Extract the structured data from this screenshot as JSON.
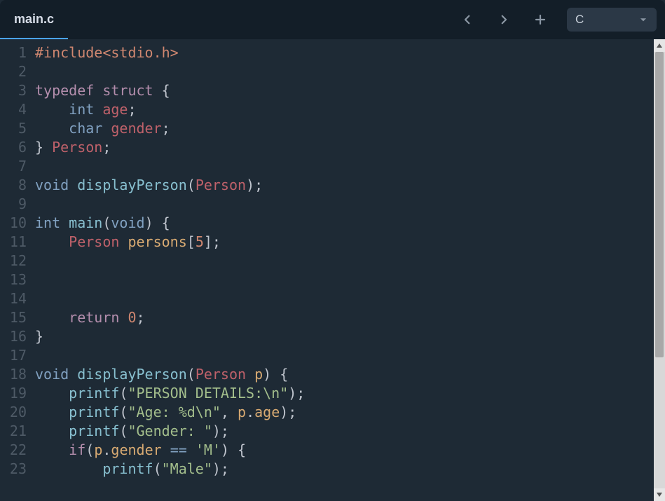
{
  "tab": {
    "filename": "main.c"
  },
  "toolbar": {
    "language": "C"
  },
  "gutter": [
    "1",
    "2",
    "3",
    "4",
    "5",
    "6",
    "7",
    "8",
    "9",
    "10",
    "11",
    "12",
    "13",
    "14",
    "15",
    "16",
    "17",
    "18",
    "19",
    "20",
    "21",
    "22",
    "23"
  ],
  "code": {
    "l1": {
      "preproc": "#include<stdio.h>"
    },
    "l3": {
      "typedef": "typedef",
      "struct": "struct",
      "brace": " {"
    },
    "l4": {
      "indent": "    ",
      "type": "int",
      "sp": " ",
      "name": "age",
      "semi": ";"
    },
    "l5": {
      "indent": "    ",
      "type": "char",
      "sp": " ",
      "name": "gender",
      "semi": ";"
    },
    "l6": {
      "brace": "} ",
      "name": "Person",
      "semi": ";"
    },
    "l8": {
      "void": "void",
      "sp": " ",
      "fn": "displayPerson",
      "open": "(",
      "param": "Person",
      "close": ");"
    },
    "l10": {
      "int": "int",
      "sp": " ",
      "fn": "main",
      "open": "(",
      "void": "void",
      "close": ") {"
    },
    "l11": {
      "indent": "    ",
      "type": "Person",
      "sp": " ",
      "name": "persons",
      "br": "[",
      "num": "5",
      "brc": "];"
    },
    "l15": {
      "indent": "    ",
      "ret": "return",
      "sp": " ",
      "num": "0",
      "semi": ";"
    },
    "l16": {
      "brace": "}"
    },
    "l18": {
      "void": "void",
      "sp": " ",
      "fn": "displayPerson",
      "open": "(",
      "type": "Person",
      "sp2": " ",
      "param": "p",
      "close": ") {"
    },
    "l19": {
      "indent": "    ",
      "fn": "printf",
      "open": "(",
      "str": "\"PERSON DETAILS:\\n\"",
      "close": ");"
    },
    "l20": {
      "indent": "    ",
      "fn": "printf",
      "open": "(",
      "str": "\"Age: %d\\n\"",
      "comma": ", ",
      "obj": "p",
      "dot": ".",
      "field": "age",
      "close": ");"
    },
    "l21": {
      "indent": "    ",
      "fn": "printf",
      "open": "(",
      "str": "\"Gender: \"",
      "close": ");"
    },
    "l22": {
      "indent": "    ",
      "if": "if",
      "open": "(",
      "obj": "p",
      "dot": ".",
      "field": "gender",
      "eq": " == ",
      "char": "'M'",
      "close": ") {"
    },
    "l23": {
      "indent": "        ",
      "fn": "printf",
      "open": "(",
      "str": "\"Male\"",
      "close": ");"
    }
  }
}
